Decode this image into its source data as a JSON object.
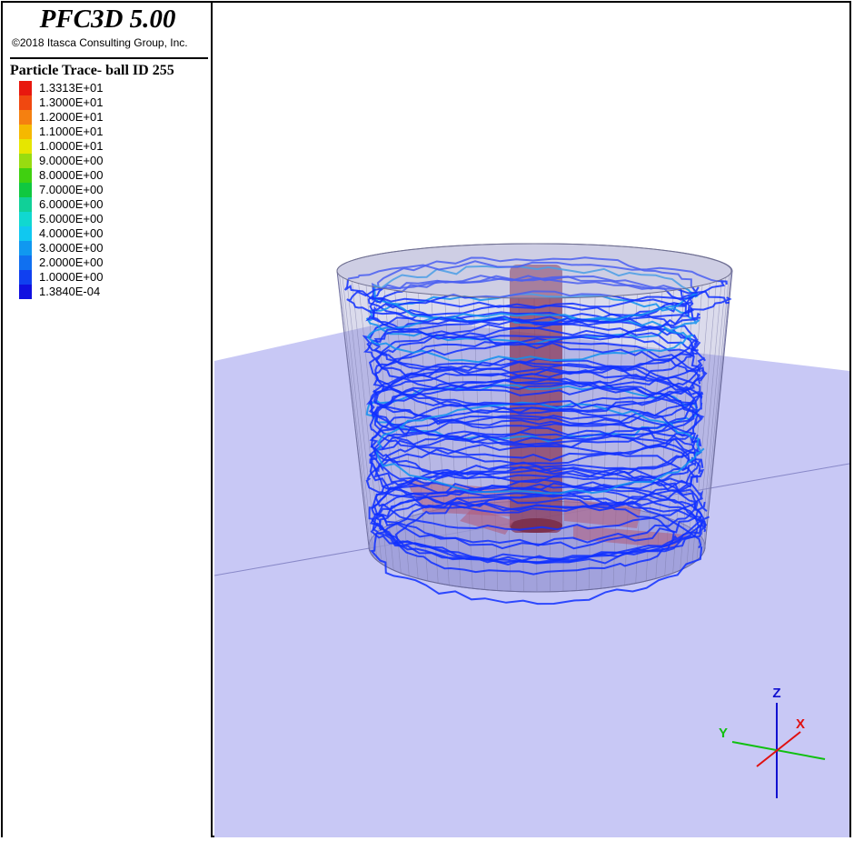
{
  "app": {
    "title": "PFC3D 5.00",
    "copyright": "©2018 Itasca Consulting Group, Inc."
  },
  "legend": {
    "title": "Particle Trace- ball  ID 255",
    "items": [
      {
        "label": "1.3313E+01",
        "color": "#e8180e"
      },
      {
        "label": "1.3000E+01",
        "color": "#f04810"
      },
      {
        "label": "1.2000E+01",
        "color": "#f58010"
      },
      {
        "label": "1.1000E+01",
        "color": "#f5b800"
      },
      {
        "label": "1.0000E+01",
        "color": "#e6e600"
      },
      {
        "label": "9.0000E+00",
        "color": "#98dc10"
      },
      {
        "label": "8.0000E+00",
        "color": "#40d010"
      },
      {
        "label": "7.0000E+00",
        "color": "#10c840"
      },
      {
        "label": "6.0000E+00",
        "color": "#10d098"
      },
      {
        "label": "5.0000E+00",
        "color": "#10d8d0"
      },
      {
        "label": "4.0000E+00",
        "color": "#10c8f0"
      },
      {
        "label": "3.0000E+00",
        "color": "#1098f0"
      },
      {
        "label": "2.0000E+00",
        "color": "#1070f0"
      },
      {
        "label": "1.0000E+00",
        "color": "#1040f0"
      },
      {
        "label": "1.3840E-04",
        "color": "#1010e0"
      }
    ]
  },
  "axes": {
    "z_label": "Z",
    "x_label": "X",
    "y_label": "Y",
    "z_color": "#1010d0",
    "x_color": "#e01010",
    "y_color": "#10c010"
  },
  "colors": {
    "plane": "#c8c8f5",
    "trace": "#1030ff",
    "rod": "#8a3a5a"
  }
}
